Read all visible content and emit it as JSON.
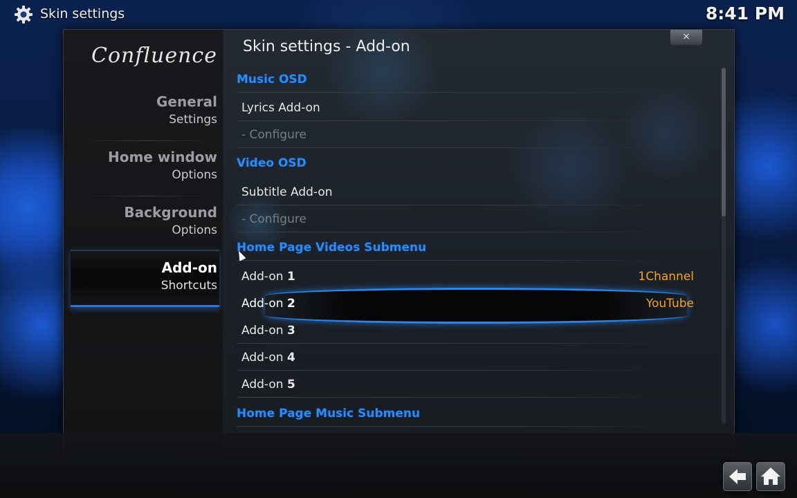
{
  "topbar": {
    "title": "Skin settings",
    "time": "8:41 PM"
  },
  "sidebar": {
    "logo": "Confluence",
    "items": [
      {
        "line1": "General",
        "line2": "Settings"
      },
      {
        "line1": "Home window",
        "line2": "Options"
      },
      {
        "line1": "Background",
        "line2": "Options"
      },
      {
        "line1": "Add-on",
        "line2": "Shortcuts"
      }
    ]
  },
  "main": {
    "heading": "Skin settings - Add-on",
    "rows": [
      {
        "label": "Music OSD",
        "kind": "section"
      },
      {
        "label": "Lyrics Add-on"
      },
      {
        "label": "- Configure",
        "kind": "dim"
      },
      {
        "label": "Video OSD",
        "kind": "section"
      },
      {
        "label": "Subtitle Add-on"
      },
      {
        "label": "- Configure",
        "kind": "dim"
      },
      {
        "label": "Home Page Videos Submenu",
        "kind": "section"
      },
      {
        "label": "Add-on",
        "num": "1",
        "value": "1Channel"
      },
      {
        "label": "Add-on",
        "num": "2",
        "value": "YouTube",
        "focused": true
      },
      {
        "label": "Add-on",
        "num": "3"
      },
      {
        "label": "Add-on",
        "num": "4"
      },
      {
        "label": "Add-on",
        "num": "5"
      },
      {
        "label": "Home Page Music Submenu",
        "kind": "section"
      }
    ]
  },
  "dialog": {
    "close_glyph": "×"
  },
  "colors": {
    "section": "#2c8cf0",
    "value": "#f7a41c",
    "highlight": "#2a87ee"
  },
  "icons": {
    "settings": "gear-icon",
    "back": "back-arrow-icon",
    "home": "home-icon"
  }
}
